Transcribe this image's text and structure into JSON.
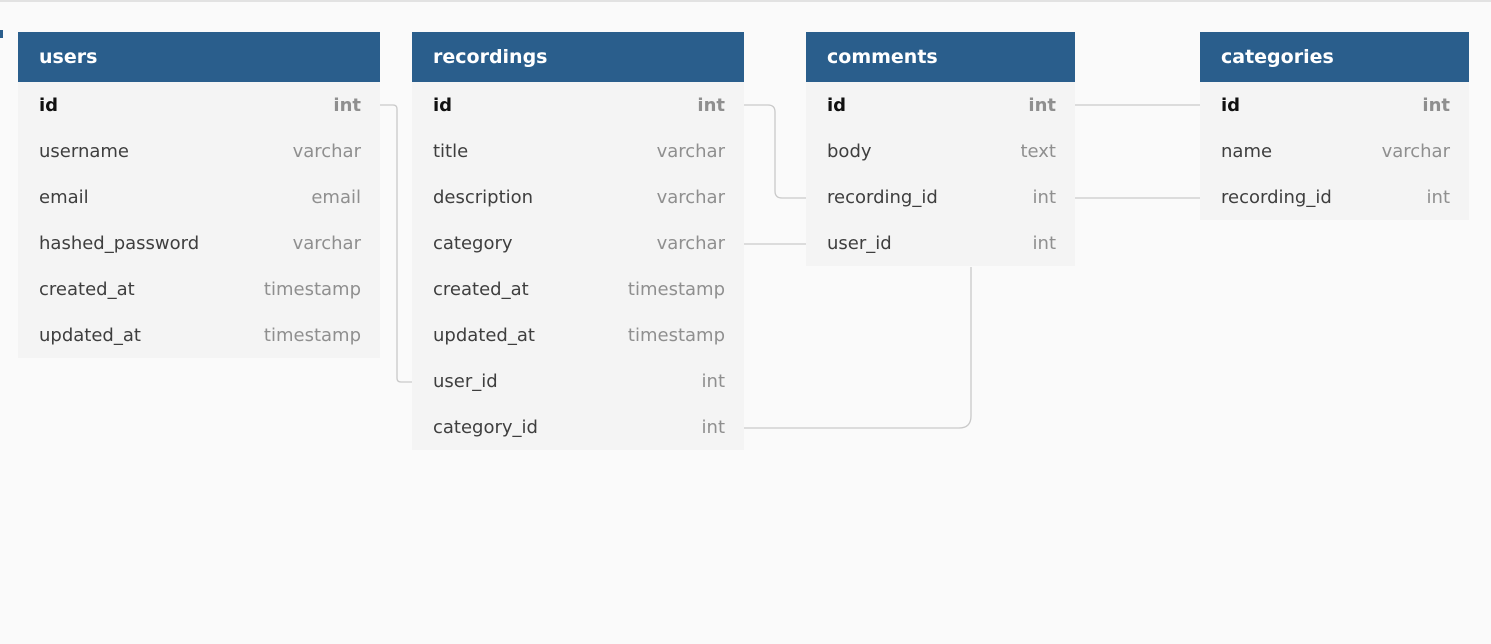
{
  "tables": [
    {
      "id": "users",
      "name": "users",
      "fields": [
        {
          "name": "id",
          "type": "int",
          "pk": true
        },
        {
          "name": "username",
          "type": "varchar"
        },
        {
          "name": "email",
          "type": "email"
        },
        {
          "name": "hashed_password",
          "type": "varchar"
        },
        {
          "name": "created_at",
          "type": "timestamp"
        },
        {
          "name": "updated_at",
          "type": "timestamp"
        }
      ]
    },
    {
      "id": "recordings",
      "name": "recordings",
      "fields": [
        {
          "name": "id",
          "type": "int",
          "pk": true
        },
        {
          "name": "title",
          "type": "varchar"
        },
        {
          "name": "description",
          "type": "varchar"
        },
        {
          "name": "category",
          "type": "varchar"
        },
        {
          "name": "created_at",
          "type": "timestamp"
        },
        {
          "name": "updated_at",
          "type": "timestamp"
        },
        {
          "name": "user_id",
          "type": "int"
        },
        {
          "name": "category_id",
          "type": "int"
        }
      ]
    },
    {
      "id": "comments",
      "name": "comments",
      "fields": [
        {
          "name": "id",
          "type": "int",
          "pk": true
        },
        {
          "name": "body",
          "type": "text"
        },
        {
          "name": "recording_id",
          "type": "int"
        },
        {
          "name": "user_id",
          "type": "int"
        }
      ]
    },
    {
      "id": "categories",
      "name": "categories",
      "fields": [
        {
          "name": "id",
          "type": "int",
          "pk": true
        },
        {
          "name": "name",
          "type": "varchar"
        },
        {
          "name": "recording_id",
          "type": "int"
        }
      ]
    }
  ],
  "relationships": [
    {
      "from": "users.id",
      "to": "recordings.user_id"
    },
    {
      "from": "recordings.id",
      "to": "comments.recording_id"
    },
    {
      "from": "recordings.category",
      "to": "comments.user_id"
    },
    {
      "from": "comments.user_id",
      "to": "recordings.category_id"
    },
    {
      "from": "comments.id",
      "to": "categories.id"
    },
    {
      "from": "comments.recording_id",
      "to": "categories.recording_id"
    }
  ],
  "colors": {
    "header": "#2a5e8c",
    "body": "#f4f4f4",
    "connector": "#c9c9c9"
  }
}
